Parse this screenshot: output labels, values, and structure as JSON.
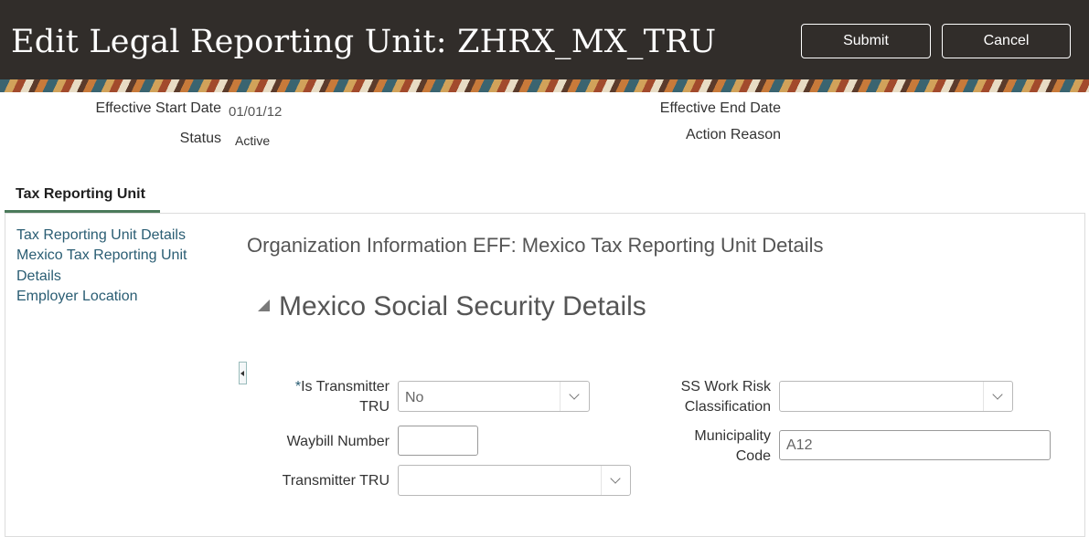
{
  "header": {
    "title": "Edit Legal Reporting Unit: ZHRX_MX_TRU",
    "submit_label": "Submit",
    "cancel_label": "Cancel"
  },
  "info": {
    "effective_start_date_label": "Effective Start Date",
    "effective_start_date_value": "01/01/12",
    "status_label": "Status",
    "status_value": "Active",
    "effective_end_date_label": "Effective End Date",
    "action_reason_label": "Action Reason"
  },
  "tabs": [
    {
      "label": "Tax Reporting Unit"
    }
  ],
  "nav": {
    "links": [
      "Tax Reporting Unit Details",
      "Mexico Tax Reporting Unit",
      "Details",
      "Employer Location"
    ]
  },
  "main": {
    "eff_title": "Organization Information EFF: Mexico Tax Reporting Unit Details",
    "section_title": "Mexico Social Security Details",
    "fields": {
      "is_transmitter_tru": {
        "required_mark": "*",
        "label_line1": "Is Transmitter",
        "label_line2": "TRU",
        "value": "No"
      },
      "waybill_number": {
        "label": "Waybill Number",
        "value": ""
      },
      "transmitter_tru": {
        "label": "Transmitter TRU",
        "value": ""
      },
      "ss_work_risk": {
        "label_line1": "SS Work Risk",
        "label_line2": "Classification",
        "value": ""
      },
      "municipality_code": {
        "label_line1": "Municipality",
        "label_line2": "Code",
        "value": "A12"
      }
    }
  },
  "colors": {
    "header_bg": "#312d2a",
    "tab_underline": "#4b7a5b",
    "link": "#2a5d73"
  }
}
